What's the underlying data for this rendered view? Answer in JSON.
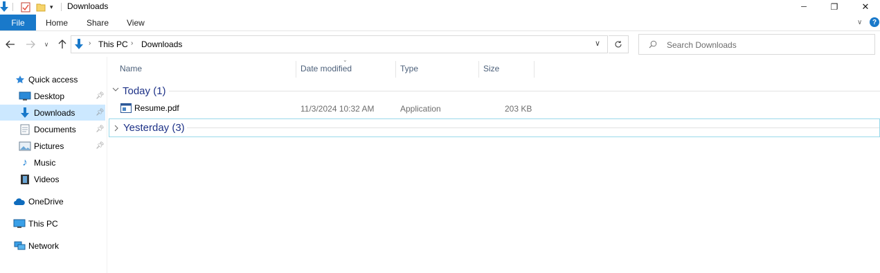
{
  "window": {
    "title": "Downloads",
    "controls": {
      "minimize": "─",
      "maximize": "❐",
      "close": "✕"
    }
  },
  "ribbon": {
    "tabs": [
      "File",
      "Home",
      "Share",
      "View"
    ],
    "accent": "#1979ca",
    "help": "?"
  },
  "nav": {
    "breadcrumb": [
      "This PC",
      "Downloads"
    ],
    "search_placeholder": "Search Downloads"
  },
  "sidebar": {
    "quick_access": "Quick access",
    "items": [
      {
        "label": "Desktop",
        "icon": "desktop-icon",
        "pinned": true
      },
      {
        "label": "Downloads",
        "icon": "downloads-icon",
        "pinned": true,
        "selected": true
      },
      {
        "label": "Documents",
        "icon": "documents-icon",
        "pinned": true
      },
      {
        "label": "Pictures",
        "icon": "pictures-icon",
        "pinned": true
      },
      {
        "label": "Music",
        "icon": "music-icon",
        "pinned": false
      },
      {
        "label": "Videos",
        "icon": "videos-icon",
        "pinned": false
      }
    ],
    "onedrive": "OneDrive",
    "this_pc": "This PC",
    "network": "Network"
  },
  "columns": [
    "Name",
    "Date modified",
    "Type",
    "Size"
  ],
  "groups": {
    "today": {
      "label": "Today (1)"
    },
    "yesterday": {
      "label": "Yesterday (3)"
    }
  },
  "files": [
    {
      "name": "Resume.pdf",
      "date": "11/3/2024 10:32 AM",
      "type": "Application",
      "size": "203 KB"
    }
  ]
}
